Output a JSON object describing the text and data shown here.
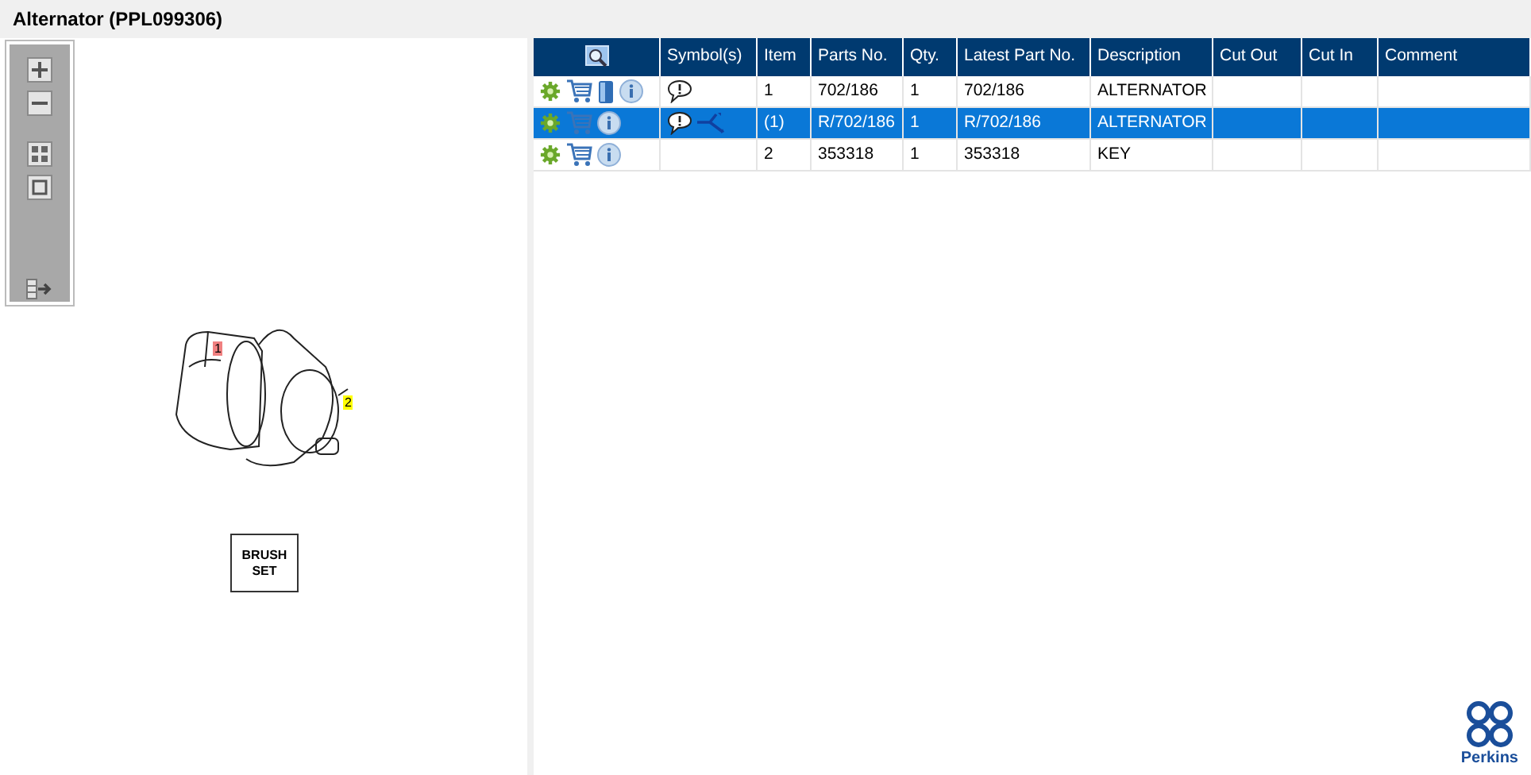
{
  "title": "Alternator (PPL099306)",
  "drawing": {
    "callouts": [
      {
        "label": "1",
        "color": "#f08080"
      },
      {
        "label": "2",
        "color": "#ffff00"
      }
    ],
    "brush_set": "BRUSH SET"
  },
  "table": {
    "columns": [
      "Symbol(s)",
      "Item",
      "Parts No.",
      "Qty.",
      "Latest Part No.",
      "Description",
      "Cut Out",
      "Cut In",
      "Comment"
    ],
    "rows": [
      {
        "selected": false,
        "manual": true,
        "note": true,
        "superseded": false,
        "item": "1",
        "parts_no": "702/186",
        "qty": "1",
        "latest": "702/186",
        "description": "ALTERNATOR"
      },
      {
        "selected": true,
        "manual": false,
        "note": true,
        "superseded": true,
        "item": "(1)",
        "parts_no": "R/702/186",
        "qty": "1",
        "latest": "R/702/186",
        "description": "ALTERNATOR"
      },
      {
        "selected": false,
        "manual": false,
        "note": false,
        "superseded": false,
        "item": "2",
        "parts_no": "353318",
        "qty": "1",
        "latest": "353318",
        "description": "KEY"
      }
    ]
  },
  "brand": "Perkins"
}
